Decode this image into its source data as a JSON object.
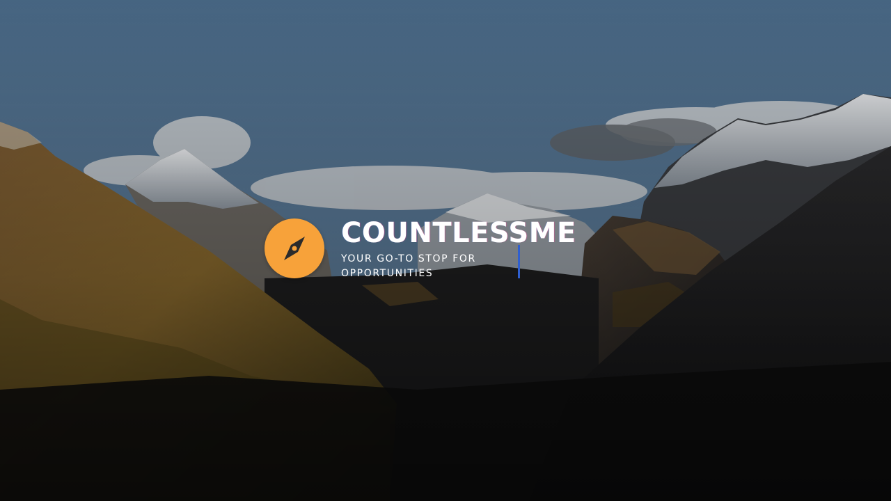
{
  "brand": {
    "name": "COUNTLESSME",
    "tagline": "YOUR GO-TO STOP FOR OPPORTUNITIES",
    "logo_icon": "compass-icon",
    "logo_color": "#f7a23a"
  },
  "background": {
    "image": "mountain-valley-photo",
    "sky_color": "#4f6f8c",
    "overlay": "dark"
  },
  "cursor": {
    "color": "#2f5fcf"
  }
}
